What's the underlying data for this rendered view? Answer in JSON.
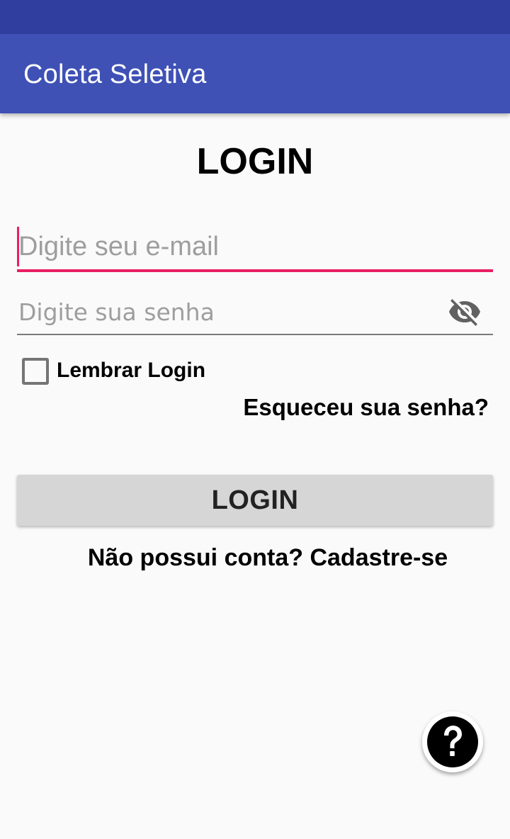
{
  "app_bar": {
    "title": "Coleta Seletiva",
    "color": "#3f51b5",
    "status_bar_color": "#303f9f"
  },
  "main": {
    "heading": "LOGIN",
    "email": {
      "value": "",
      "placeholder": "Digite seu e-mail",
      "accent_color": "#e91e63"
    },
    "password": {
      "value": "",
      "placeholder": "Digite sua senha",
      "toggle_icon": "eye-off-icon"
    },
    "remember": {
      "label": "Lembrar Login",
      "checked": false
    },
    "forgot_label": "Esqueceu sua senha?",
    "login_button_label": "LOGIN",
    "signup_label": "Não possui conta? Cadastre-se"
  },
  "help_fab": {
    "icon": "help-question-icon"
  }
}
